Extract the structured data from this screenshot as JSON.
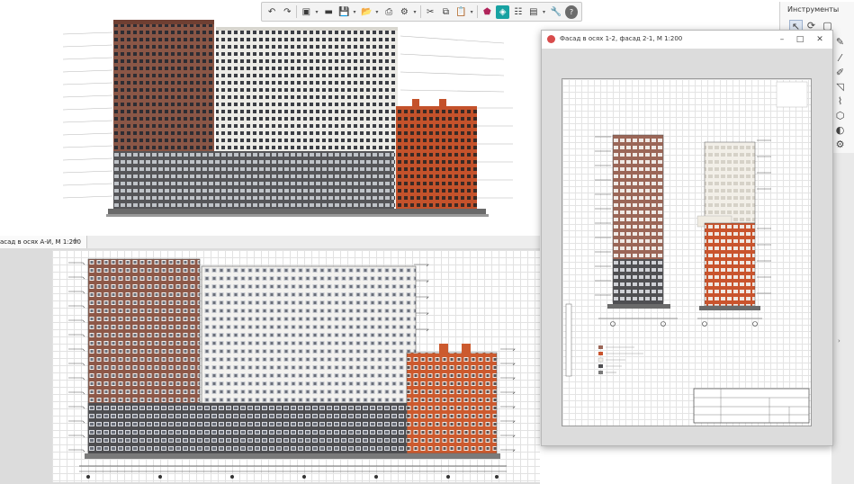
{
  "toolbar": {
    "buttons": [
      "undo-icon",
      "redo-icon",
      "view3d-icon",
      "sheet-icon",
      "save-icon",
      "open-icon",
      "print-icon",
      "settings-icon",
      "cut-icon",
      "copy-icon",
      "paste-icon",
      "shield-icon",
      "model-icon",
      "layers-icon",
      "properties-icon",
      "wrench-icon",
      "help-icon"
    ]
  },
  "tools_panel": {
    "title": "Инструменты"
  },
  "view2d": {
    "tab_label": "асад в осях А-И, М 1:200",
    "tab_add": "+"
  },
  "window": {
    "title": "Фасад в осях 1-2, фасад 2-1, М 1:200",
    "minimize": "–",
    "maximize": "□",
    "close": "✕"
  },
  "colors": {
    "brick": "#8a5646",
    "orange": "#c0502a",
    "white_facade": "#f0eeea",
    "dark_base": "#4a4a4a"
  }
}
